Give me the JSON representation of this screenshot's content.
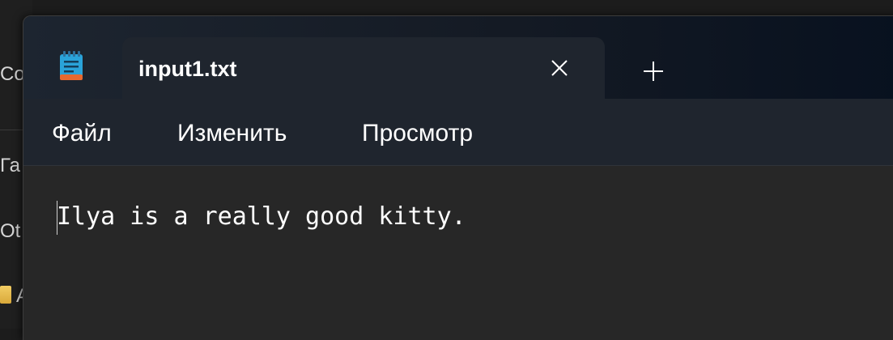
{
  "background_window": {
    "partial_labels": [
      "Соз",
      "Га",
      "Ot",
      "А"
    ]
  },
  "app": {
    "icon": "notepad-icon"
  },
  "tabs": [
    {
      "label": "input1.txt",
      "close_icon": "close-icon"
    }
  ],
  "new_tab_icon": "plus-icon",
  "menu": {
    "file": "Файл",
    "edit": "Изменить",
    "view": "Просмотр"
  },
  "editor": {
    "content": "Ilya is a really good kitty."
  },
  "colors": {
    "titlebar": "#141a24",
    "menubar": "#1f252e",
    "editor_bg": "#272727",
    "text": "#ffffff"
  }
}
